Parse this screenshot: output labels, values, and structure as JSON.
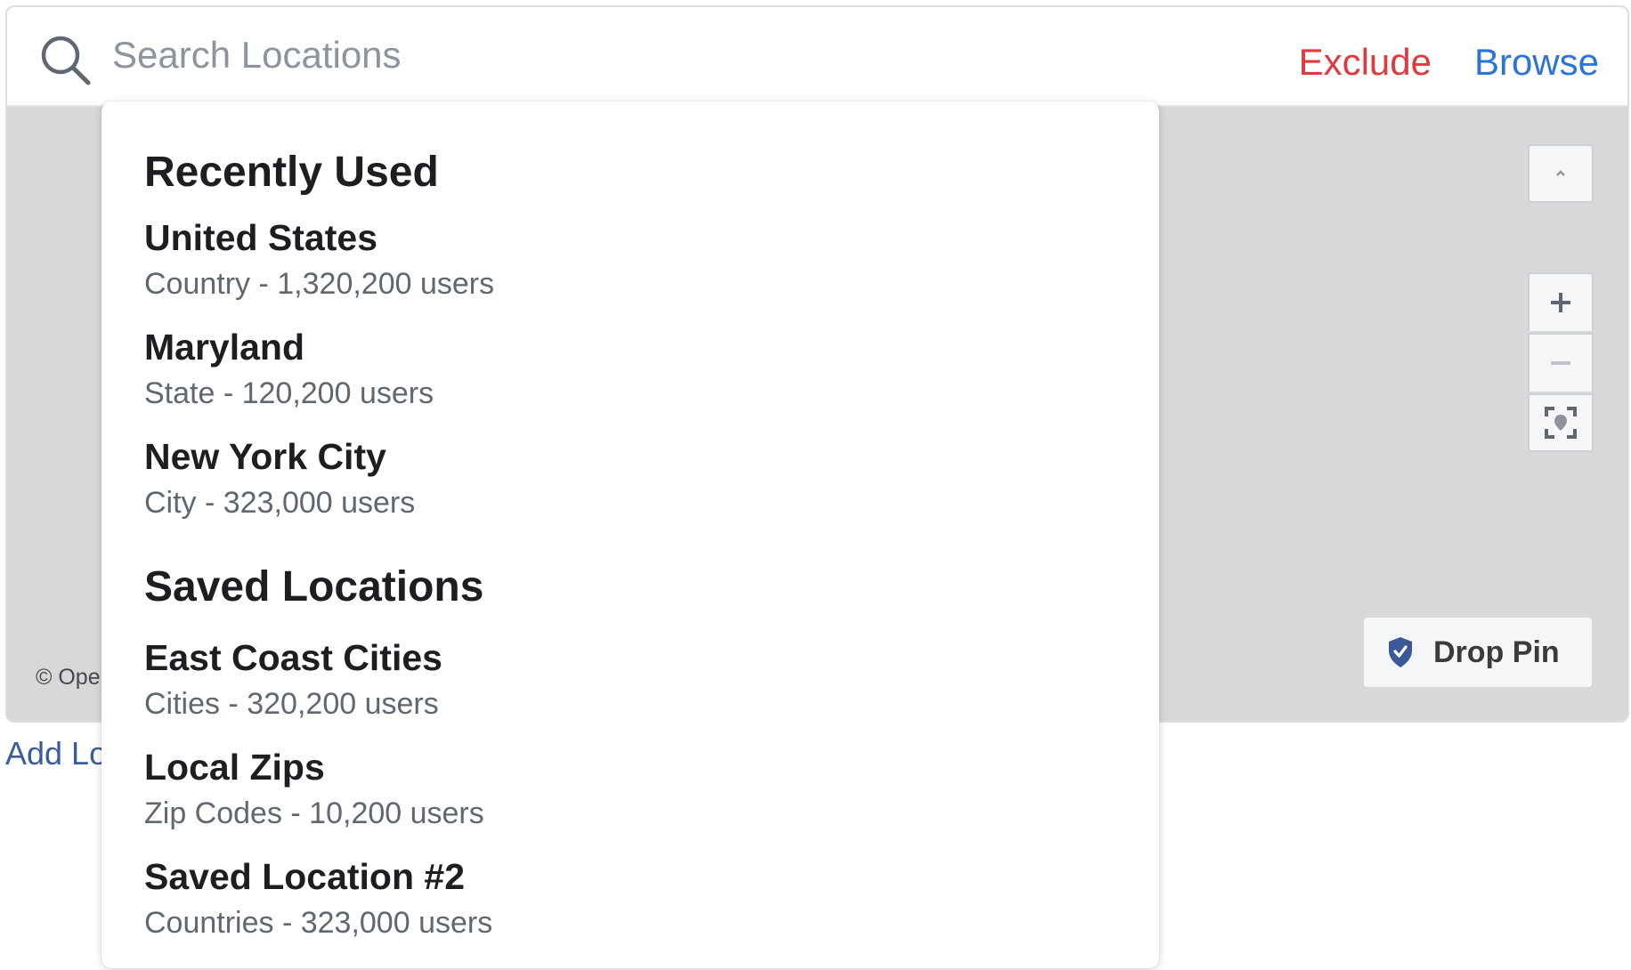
{
  "search": {
    "placeholder": "Search Locations",
    "value": "",
    "exclude_label": "Exclude",
    "browse_label": "Browse"
  },
  "map": {
    "attribution": "© OpenStreetMap contributors",
    "collapse_icon": "chevron-up-icon",
    "zoom_in_label": "+",
    "zoom_out_label": "−",
    "locate_icon": "locate-icon",
    "drop_pin_label": "Drop Pin"
  },
  "add_location_label": "Add Locations in Bulk",
  "dropdown": {
    "recent_title": "Recently Used",
    "recent": [
      {
        "name": "United States",
        "meta": "Country - 1,320,200 users"
      },
      {
        "name": "Maryland",
        "meta": "State - 120,200 users"
      },
      {
        "name": "New York City",
        "meta": "City - 323,000 users"
      }
    ],
    "saved_title": "Saved Locations",
    "saved": [
      {
        "name": "East Coast Cities",
        "meta": "Cities - 320,200 users"
      },
      {
        "name": "Local Zips",
        "meta": "Zip Codes - 10,200 users"
      },
      {
        "name": "Saved Location #2",
        "meta": "Countries - 323,000 users"
      }
    ]
  },
  "colors": {
    "exclude": "#e0393e",
    "browse": "#2d74da",
    "map_bg": "#d8d8d8",
    "pin_blue": "#3b5998"
  }
}
